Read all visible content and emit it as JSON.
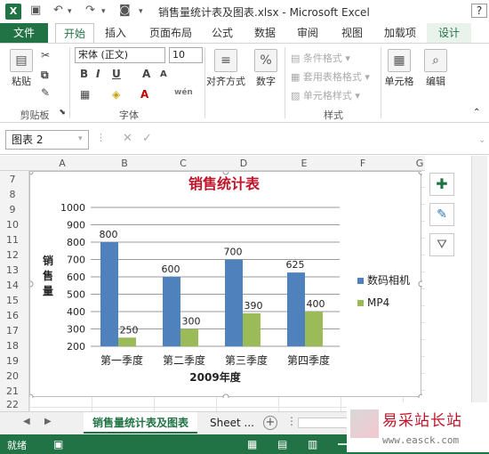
{
  "window": {
    "title": "销售量统计表及图表.xlsx - Microsoft Excel",
    "help": "?"
  },
  "tabs": {
    "file": "文件",
    "items": [
      "开始",
      "插入",
      "页面布局",
      "公式",
      "数据",
      "审阅",
      "视图",
      "加载项",
      "设计"
    ]
  },
  "ribbon": {
    "paste": "粘贴",
    "clipboard": "剪贴板",
    "font_name": "宋体 (正文)",
    "font_size": "10",
    "font_group": "字体",
    "align": "对齐方式",
    "number": "数字",
    "style_items": [
      "条件格式",
      "套用表格格式",
      "单元格样式"
    ],
    "styles_group": "样式",
    "cells": "单元格",
    "edit": "编辑"
  },
  "formula": {
    "namebox": "图表 2"
  },
  "columns": [
    "A",
    "B",
    "C",
    "D",
    "E",
    "F",
    "G"
  ],
  "rows": [
    "7",
    "8",
    "9",
    "10",
    "11",
    "12",
    "13",
    "14",
    "15",
    "16",
    "17",
    "18",
    "19",
    "20",
    "21",
    "22"
  ],
  "chart_data": {
    "type": "bar",
    "title": "销售统计表",
    "categories": [
      "第一季度",
      "第二季度",
      "第三季度",
      "第四季度"
    ],
    "series": [
      {
        "name": "数码相机",
        "values": [
          800,
          600,
          700,
          625
        ],
        "color": "#4f81bd"
      },
      {
        "name": "MP4",
        "values": [
          250,
          300,
          390,
          400
        ],
        "color": "#9bbb59"
      }
    ],
    "xlabel": "2009年度",
    "ylabel": "销售量",
    "ylim": [
      200,
      1000
    ],
    "yticks": [
      "1000",
      "900",
      "800",
      "700",
      "600",
      "500",
      "400",
      "300",
      "200"
    ],
    "grid": true,
    "legend": "right"
  },
  "sheets": {
    "active": "销售量统计表及图表",
    "other": "Sheet ..."
  },
  "status": {
    "text": "就绪"
  },
  "watermark": {
    "title": "易采站长站",
    "url": "www.easck.com"
  },
  "colors": {
    "accent": "#217346",
    "title_red": "#c0142a"
  }
}
